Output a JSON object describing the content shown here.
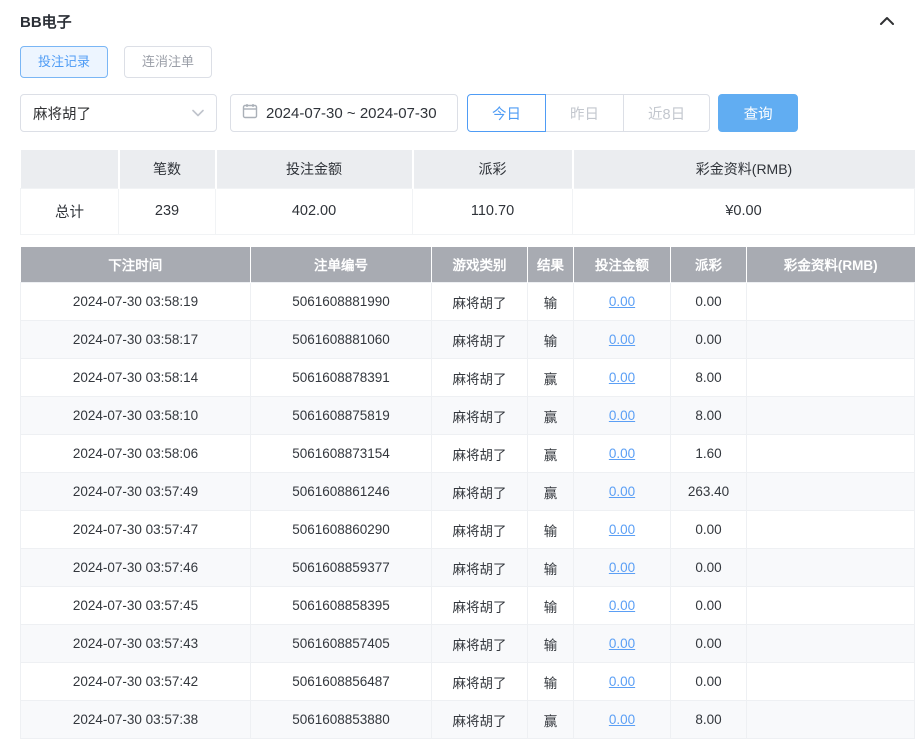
{
  "header": {
    "title": "BB电子"
  },
  "tabs": [
    {
      "label": "投注记录",
      "active": true
    },
    {
      "label": "连消注单",
      "active": false
    }
  ],
  "filters": {
    "game_select_value": "麻将胡了",
    "date_range": "2024-07-30 ~ 2024-07-30",
    "quick_buttons": [
      {
        "label": "今日",
        "active": true
      },
      {
        "label": "昨日",
        "active": false
      },
      {
        "label": "近8日",
        "active": false
      }
    ],
    "search_label": "查询"
  },
  "summary": {
    "headers": [
      "",
      "笔数",
      "投注金额",
      "派彩",
      "彩金资料(RMB)"
    ],
    "row": [
      "总计",
      "239",
      "402.00",
      "110.70",
      "¥0.00"
    ]
  },
  "table": {
    "headers": [
      "下注时间",
      "注单编号",
      "游戏类别",
      "结果",
      "投注金额",
      "派彩",
      "彩金资料(RMB)"
    ],
    "rows": [
      [
        "2024-07-30 03:58:19",
        "5061608881990",
        "麻将胡了",
        "输",
        "0.00",
        "0.00",
        ""
      ],
      [
        "2024-07-30 03:58:17",
        "5061608881060",
        "麻将胡了",
        "输",
        "0.00",
        "0.00",
        ""
      ],
      [
        "2024-07-30 03:58:14",
        "5061608878391",
        "麻将胡了",
        "赢",
        "0.00",
        "8.00",
        ""
      ],
      [
        "2024-07-30 03:58:10",
        "5061608875819",
        "麻将胡了",
        "赢",
        "0.00",
        "8.00",
        ""
      ],
      [
        "2024-07-30 03:58:06",
        "5061608873154",
        "麻将胡了",
        "赢",
        "0.00",
        "1.60",
        ""
      ],
      [
        "2024-07-30 03:57:49",
        "5061608861246",
        "麻将胡了",
        "赢",
        "0.00",
        "263.40",
        ""
      ],
      [
        "2024-07-30 03:57:47",
        "5061608860290",
        "麻将胡了",
        "输",
        "0.00",
        "0.00",
        ""
      ],
      [
        "2024-07-30 03:57:46",
        "5061608859377",
        "麻将胡了",
        "输",
        "0.00",
        "0.00",
        ""
      ],
      [
        "2024-07-30 03:57:45",
        "5061608858395",
        "麻将胡了",
        "输",
        "0.00",
        "0.00",
        ""
      ],
      [
        "2024-07-30 03:57:43",
        "5061608857405",
        "麻将胡了",
        "输",
        "0.00",
        "0.00",
        ""
      ],
      [
        "2024-07-30 03:57:42",
        "5061608856487",
        "麻将胡了",
        "输",
        "0.00",
        "0.00",
        ""
      ],
      [
        "2024-07-30 03:57:38",
        "5061608853880",
        "麻将胡了",
        "赢",
        "0.00",
        "8.00",
        ""
      ]
    ]
  },
  "colors": {
    "accent_blue": "#4f9cf5",
    "search_button_blue": "#61adf2",
    "table_header_gray": "#a8abb2",
    "link_blue": "#5b9ff5"
  }
}
